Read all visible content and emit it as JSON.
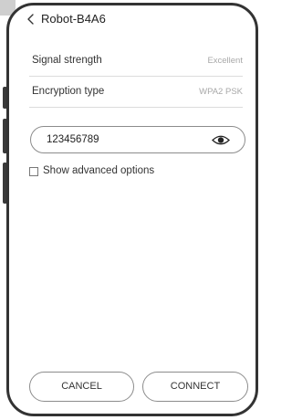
{
  "header": {
    "title": "Robot-B4A6"
  },
  "info": {
    "signal_label": "Signal strength",
    "signal_value": "Excellent",
    "encryption_label": "Encryption type",
    "encryption_value": "WPA2 PSK"
  },
  "password": {
    "value": "123456789",
    "icon": "eye-icon"
  },
  "options": {
    "advanced_label": "Show advanced options",
    "advanced_checked": false
  },
  "actions": {
    "cancel_label": "CANCEL",
    "connect_label": "CONNECT"
  },
  "colors": {
    "frame": "#333333",
    "text": "#333333",
    "muted_value": "#a8a8a8",
    "border": "#8c8c8c"
  }
}
